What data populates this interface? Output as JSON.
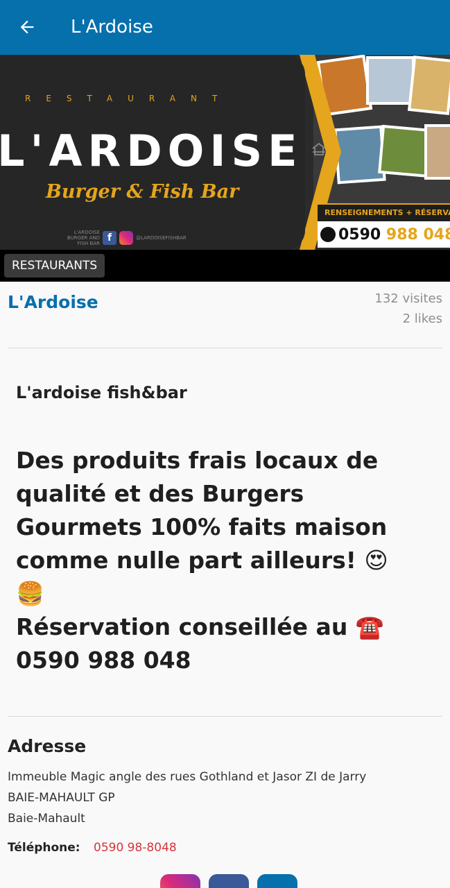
{
  "appbar": {
    "title": "L'Ardoise",
    "back_icon": "arrow-left-icon"
  },
  "hero": {
    "tagline": "RESTAURANT",
    "name": "L'ARDOISE",
    "subtitle": "Burger & Fish Bar",
    "social_caption": "L'ARDOISE BURGER AND FISH BAR",
    "social_handle": "@LARDOISEFISHBAR",
    "band_text": "RENSEIGNEMENTS + RÉSERVA",
    "phone_prefix": "0590 ",
    "phone_suffix": "988 048"
  },
  "category": {
    "label": "RESTAURANTS"
  },
  "place": {
    "name": "L'Ardoise",
    "visits": "132 visites",
    "likes": "2 likes"
  },
  "description": {
    "title": "L'ardoise fish&bar",
    "lines": [
      "Des produits frais locaux de",
      "qualité et des Burgers",
      "Gourmets 100% faits maison",
      "comme nulle part ailleurs! 😍",
      "🍔",
      "Réservation conseillée au ☎️",
      "0590 988 048"
    ]
  },
  "address": {
    "heading": "Adresse",
    "line1": "Immeuble Magic angle des rues Gothland et Jasor ZI de Jarry",
    "line2": "BAIE-MAHAULT GP",
    "line3": "Baie-Mahault"
  },
  "phone": {
    "label": "Téléphone:",
    "value": "0590 98-8048"
  },
  "social_icons": [
    "instagram-icon",
    "facebook-icon",
    "website-icon"
  ],
  "colors": {
    "primary": "#0670ad",
    "accent": "#e5a51c",
    "phone": "#d9343a"
  }
}
